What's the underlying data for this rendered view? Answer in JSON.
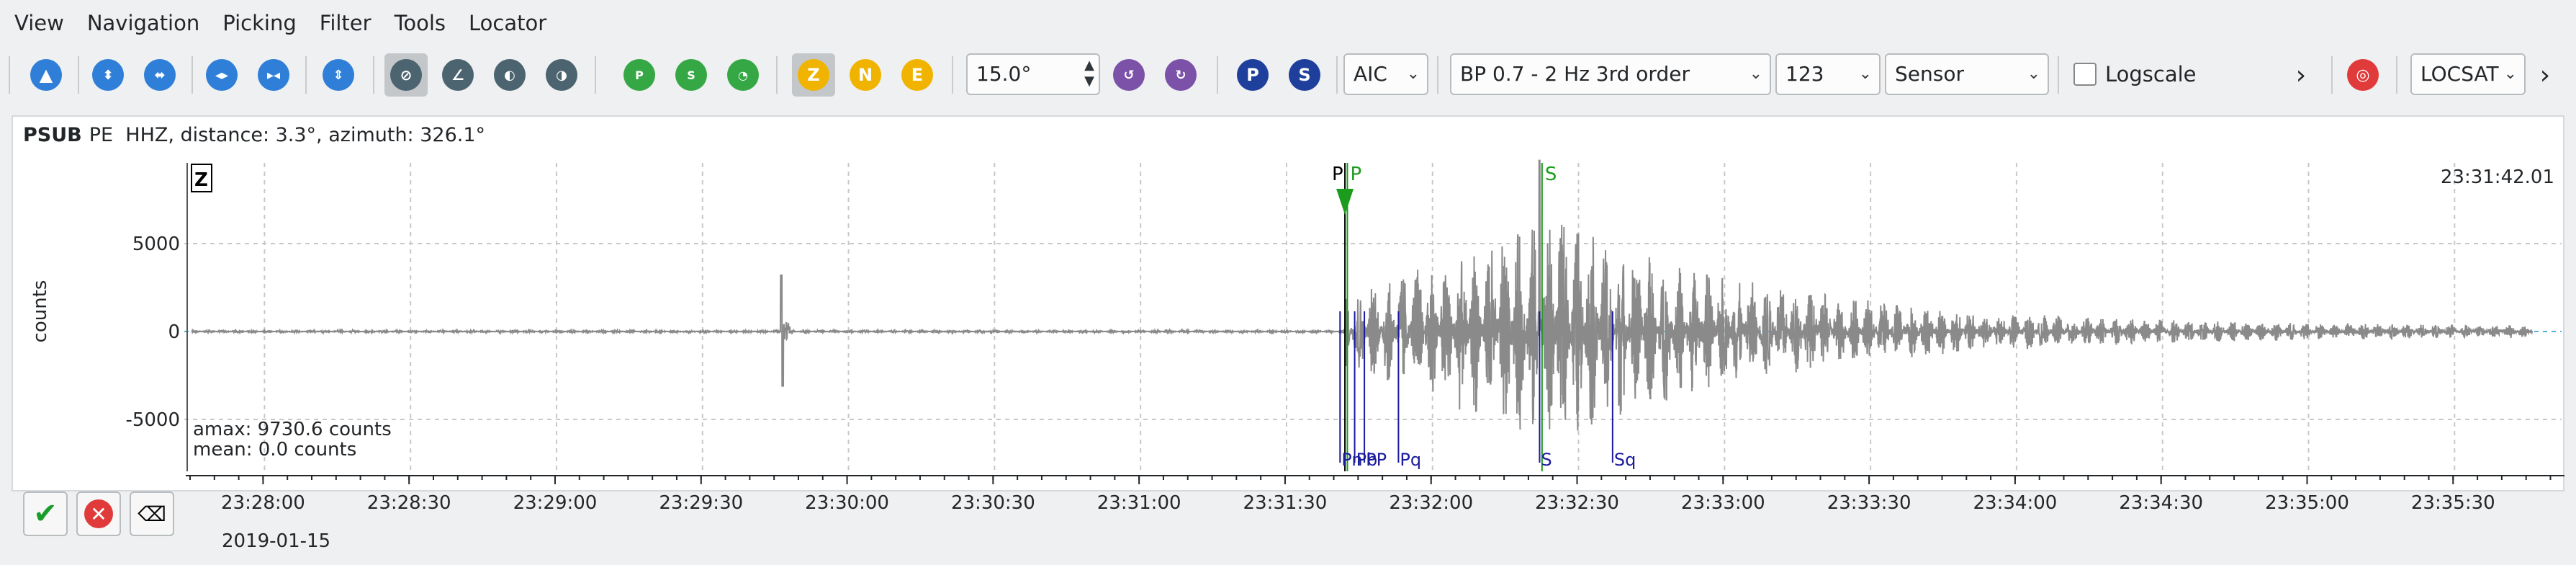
{
  "menu": [
    "View",
    "Navigation",
    "Picking",
    "Filter",
    "Tools",
    "Locator"
  ],
  "toolbar": {
    "phase_buttons": [
      "Z",
      "N",
      "E"
    ],
    "angle_value": "15.0°",
    "pick_buttons": [
      "P",
      "S"
    ],
    "aic_label": "AIC",
    "filter_label": "BP 0.7 - 2 Hz  3rd order",
    "channel_label": "123",
    "unit_label": "Sensor",
    "logscale_label": "Logscale",
    "more_label": "›",
    "locator_label": "LOCSAT",
    "overflow_label": "›",
    "colors": {
      "blue_btn": "#2f7fd8",
      "green_btn": "#35a845",
      "gray_btn": "#4c6470",
      "yellow_btn": "#f0b400",
      "purple_btn": "#7b52a8",
      "navy_btn": "#1e3f9c",
      "red_btn": "#e03a3a"
    }
  },
  "trace": {
    "station": "PSUB",
    "network": "PE",
    "info": "HHZ, distance: 3.3°, azimuth: 326.1°",
    "component": "Z",
    "time_label": "23:31:42.01",
    "ylabel": "counts",
    "amax": "amax: 9730.6 counts",
    "mean": "mean: 0.0 counts"
  },
  "chart_data": {
    "type": "line",
    "xlabel": "",
    "ylabel": "counts",
    "yticks": [
      5000,
      0,
      -5000
    ],
    "ylim": [
      -7800,
      9730.6
    ],
    "xticks": [
      "23:28:00",
      "23:28:30",
      "23:29:00",
      "23:29:30",
      "23:30:00",
      "23:30:30",
      "23:31:00",
      "23:31:30",
      "23:32:00",
      "23:32:30",
      "23:33:00",
      "23:33:30",
      "23:34:00",
      "23:34:30",
      "23:35:00",
      "23:35:30"
    ],
    "xlim_seconds_after_23_27_45": [
      0,
      487
    ],
    "grid": true,
    "signal": {
      "spike_time": "23:29:46",
      "spike_peak": 3200,
      "spike_trough": -3100,
      "onset_time": "23:31:42",
      "peak_time": "23:32:24",
      "peak_amplitude": 9730.6,
      "end_time": "23:35:46"
    },
    "picks": [
      {
        "label": "P",
        "time": "23:31:42",
        "color": "#000000",
        "position": "top"
      },
      {
        "label": "P",
        "time": "23:31:42.5",
        "color": "#1c9c1c",
        "position": "top"
      },
      {
        "label": "S",
        "time": "23:32:22.5",
        "color": "#1c9c1c",
        "position": "top"
      }
    ],
    "theoretical_picks": [
      {
        "label": "Pn",
        "time": "23:31:41"
      },
      {
        "label": "Pb",
        "time": "23:31:44"
      },
      {
        "label": "PP",
        "time": "23:31:46"
      },
      {
        "label": "Pq",
        "time": "23:31:53"
      },
      {
        "label": "S",
        "time": "23:32:22"
      },
      {
        "label": "Sq",
        "time": "23:32:37"
      }
    ]
  },
  "bottom": {
    "date": "2019-01-15"
  }
}
